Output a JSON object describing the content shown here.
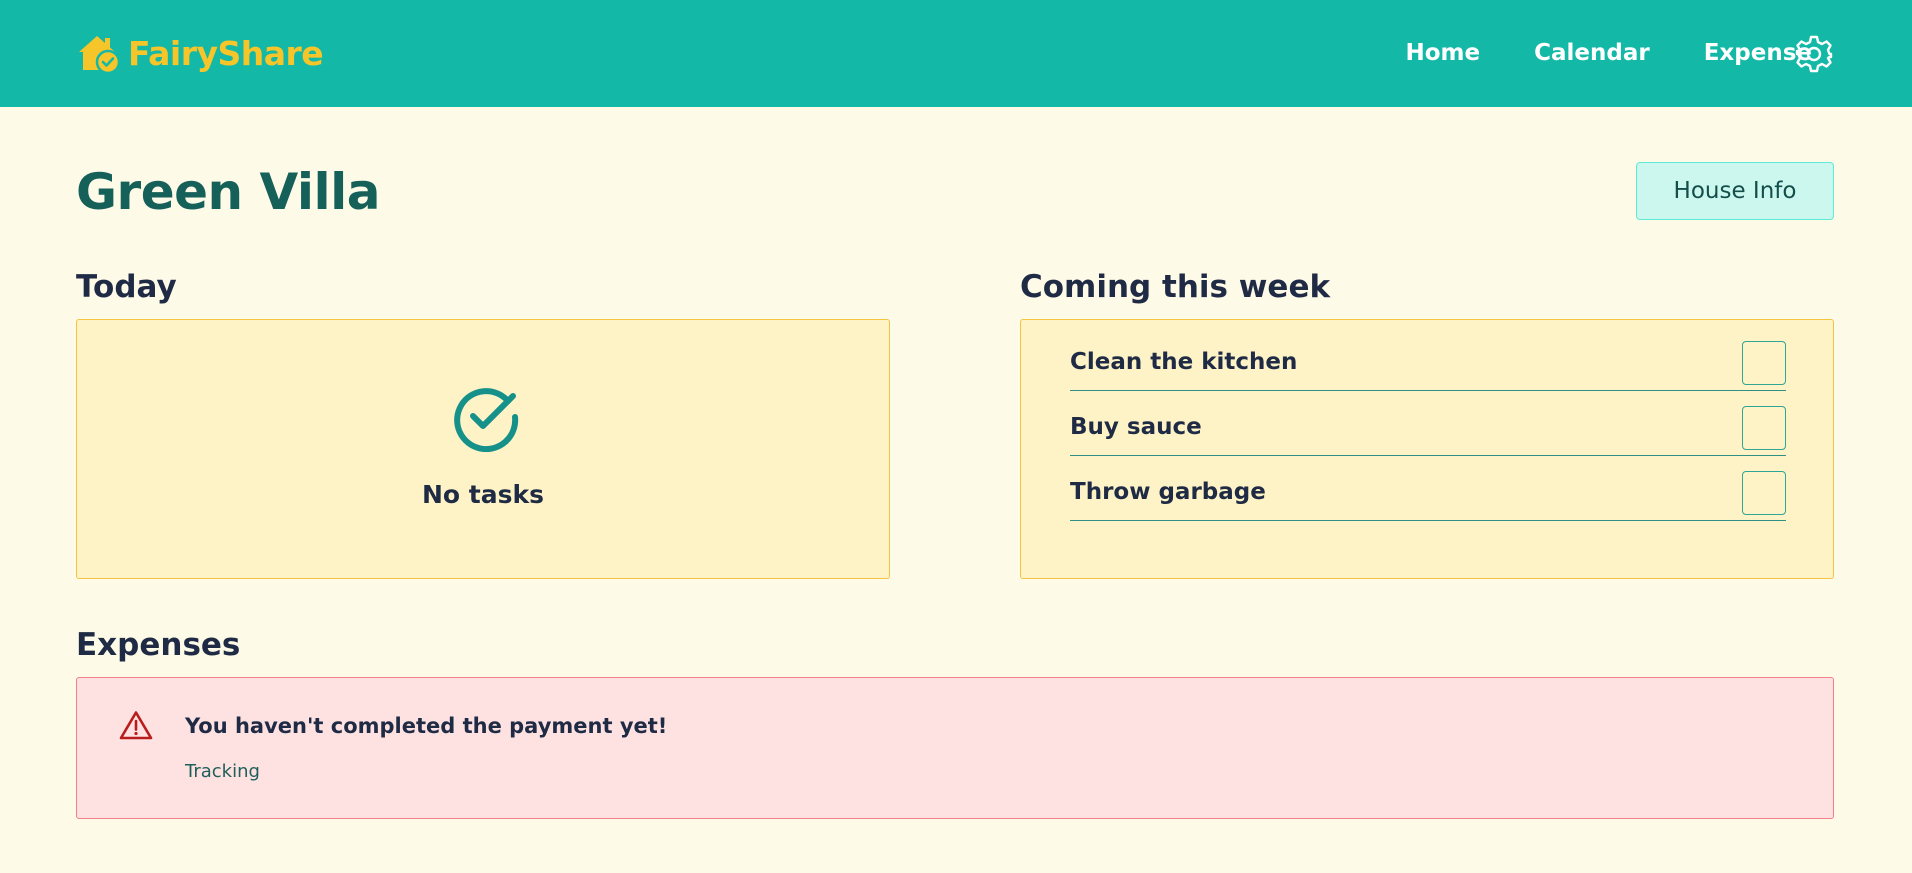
{
  "brand": {
    "name": "FairyShare",
    "logo_icon": "house-check-icon",
    "logo_color": "#f6c52a"
  },
  "nav": {
    "items": [
      {
        "label": "Home"
      },
      {
        "label": "Calendar"
      },
      {
        "label": "Expense"
      }
    ],
    "settings_icon": "gear-icon"
  },
  "page": {
    "title": "Green Villa",
    "house_info_label": "House Info"
  },
  "today": {
    "title": "Today",
    "empty_icon": "check-circle-icon",
    "empty_text": "No tasks"
  },
  "week": {
    "title": "Coming this week",
    "tasks": [
      {
        "label": "Clean the kitchen",
        "checked": false
      },
      {
        "label": "Buy sauce",
        "checked": false
      },
      {
        "label": "Throw garbage",
        "checked": false
      }
    ]
  },
  "expenses": {
    "title": "Expenses",
    "alert_icon": "warning-triangle-icon",
    "message": "You haven't completed the payment yet!",
    "link_label": "Tracking"
  },
  "colors": {
    "header_bg": "#14b8a6",
    "page_bg": "#fefae8",
    "title_teal": "#16605a",
    "panel_bg": "#fef3c7",
    "alert_bg": "#fee2e2",
    "alert_icon": "#b91c1c"
  }
}
